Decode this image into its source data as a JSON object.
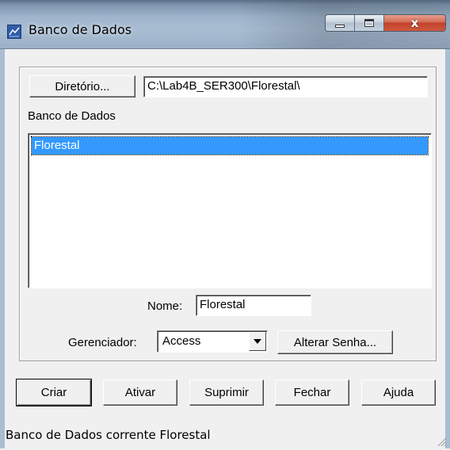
{
  "window": {
    "title": "Banco de Dados",
    "controls": {
      "minimize": "minimize",
      "maximize": "maximize",
      "close": "x"
    }
  },
  "directory": {
    "button_label": "Diretório...",
    "path_value": "C:\\Lab4B_SER300\\Florestal\\"
  },
  "database_list": {
    "label": "Banco de Dados",
    "items": [
      "Florestal"
    ],
    "selected": "Florestal"
  },
  "name_field": {
    "label": "Nome:",
    "value": "Florestal"
  },
  "manager": {
    "label": "Gerenciador:",
    "selected": "Access",
    "change_password_label": "Alterar Senha..."
  },
  "actions": {
    "create": "Criar",
    "activate": "Ativar",
    "delete": "Suprimir",
    "close": "Fechar",
    "help": "Ajuda"
  },
  "status": {
    "text": "Banco de Dados corrente Florestal"
  },
  "colors": {
    "selection": "#3399ff",
    "titlebar": "#a9bdd2",
    "close_button": "#c2412a"
  },
  "icons": [
    "app-icon",
    "minimize-icon",
    "maximize-icon",
    "close-icon",
    "chevron-down-icon",
    "resize-grip-icon"
  ]
}
